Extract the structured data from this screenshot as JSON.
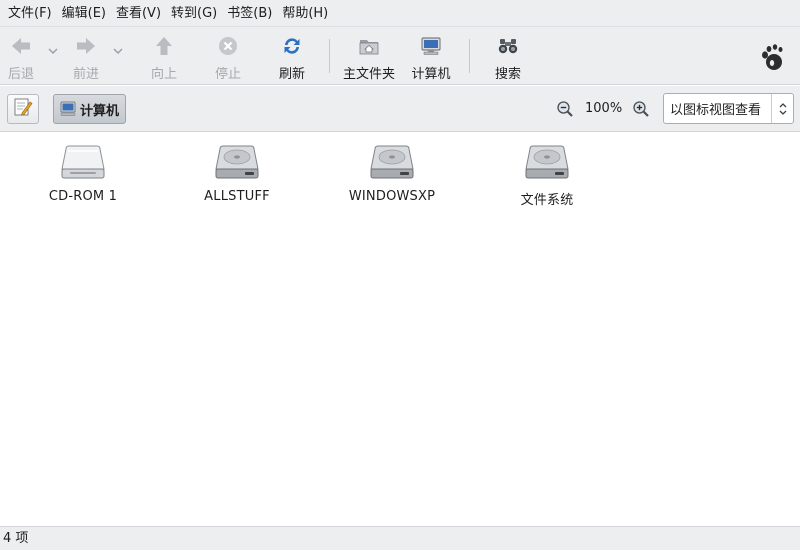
{
  "menubar": {
    "items": [
      {
        "label": "文件(F)"
      },
      {
        "label": "编辑(E)"
      },
      {
        "label": "查看(V)"
      },
      {
        "label": "转到(G)"
      },
      {
        "label": "书签(B)"
      },
      {
        "label": "帮助(H)"
      }
    ]
  },
  "toolbar": {
    "back_label": "后退",
    "forward_label": "前进",
    "up_label": "向上",
    "stop_label": "停止",
    "reload_label": "刷新",
    "home_label": "主文件夹",
    "computer_label": "计算机",
    "search_label": "搜索",
    "icons": {
      "back": "arrow-left-icon",
      "forward": "arrow-right-icon",
      "up": "arrow-up-icon",
      "stop": "stop-icon",
      "reload": "refresh-icon",
      "home": "home-folder-icon",
      "computer": "computer-icon",
      "search": "binoculars-icon",
      "logo": "gnome-foot-icon"
    }
  },
  "location": {
    "path_label": "计算机",
    "zoom_level": "100%",
    "view_mode": "以图标视图查看"
  },
  "drives": [
    {
      "name": "CD-ROM 1",
      "icon": "optical-drive-icon"
    },
    {
      "name": "ALLSTUFF",
      "icon": "hard-disk-icon"
    },
    {
      "name": "WINDOWSXP",
      "icon": "hard-disk-icon"
    },
    {
      "name": "文件系统",
      "icon": "hard-disk-icon"
    }
  ],
  "status": {
    "text": "4 项"
  },
  "colors": {
    "chrome_bg": "#eceef0",
    "refresh_blue": "#2f6fc0",
    "disabled": "#a6a8ab"
  }
}
